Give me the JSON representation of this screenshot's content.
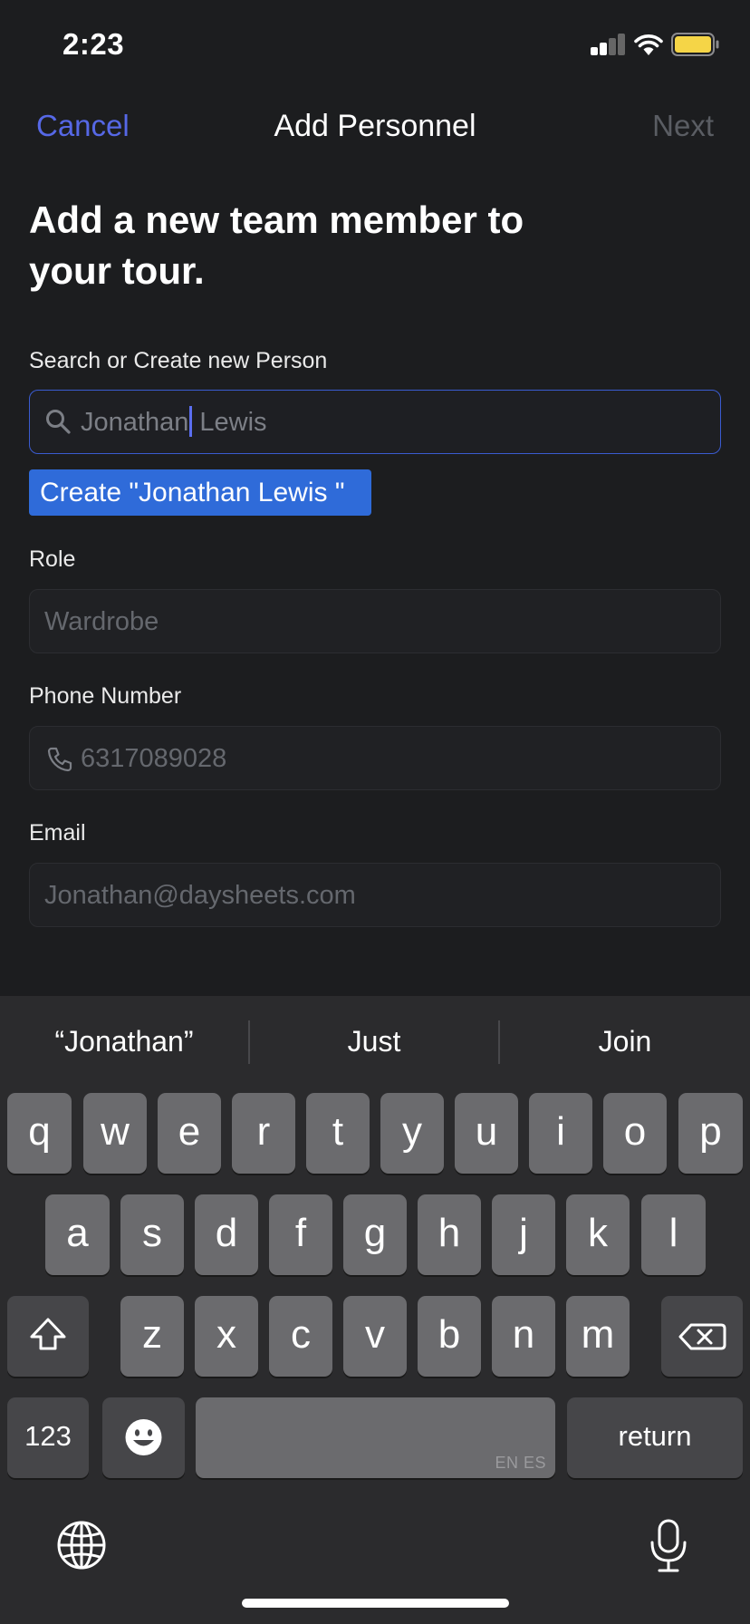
{
  "status_bar": {
    "time": "2:23"
  },
  "nav": {
    "cancel": "Cancel",
    "title": "Add Personnel",
    "next": "Next"
  },
  "heading": "Add a new team member to your tour.",
  "search": {
    "label": "Search or Create new Person",
    "typed": "Jonathan",
    "suggestion_rest": " Lewis",
    "create_label": "Create \"Jonathan Lewis \""
  },
  "role": {
    "label": "Role",
    "placeholder": "Wardrobe"
  },
  "phone": {
    "label": "Phone Number",
    "placeholder": "6317089028"
  },
  "email": {
    "label": "Email",
    "placeholder": "Jonathan@daysheets.com"
  },
  "keyboard": {
    "suggestions": [
      "“Jonathan”",
      "Just",
      "Join"
    ],
    "row1": [
      "q",
      "w",
      "e",
      "r",
      "t",
      "y",
      "u",
      "i",
      "o",
      "p"
    ],
    "row2": [
      "a",
      "s",
      "d",
      "f",
      "g",
      "h",
      "j",
      "k",
      "l"
    ],
    "row3": [
      "z",
      "x",
      "c",
      "v",
      "b",
      "n",
      "m"
    ],
    "numbers_key": "123",
    "return_key": "return",
    "space_languages": "EN ES"
  },
  "colors": {
    "accent": "#5668e6",
    "create_button": "#2f6bd9",
    "background": "#1c1d1f"
  }
}
